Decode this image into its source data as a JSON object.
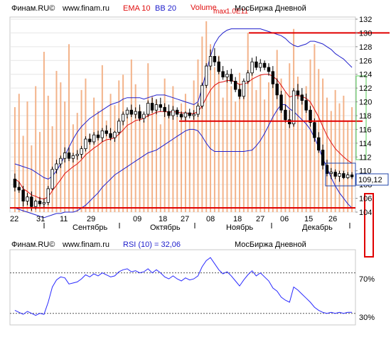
{
  "colors": {
    "frame": "#cccccc",
    "plot_bg": "#ffffff",
    "outer_bg": "#ffffff",
    "volume": "#f3b38a",
    "ema": "#e01010",
    "bollinger": "#2020cc",
    "rsi": "#2a2aff",
    "annotation_red": "#e00000",
    "annotation_blue": "#2244aa",
    "annotation_green": "#55cc55",
    "grid": "#e6e6e6",
    "text": "#000000"
  },
  "main_panel": {
    "source_label": "Финам.RU©",
    "site_label": "www.finam.ru",
    "ema_label": "EMA 10",
    "bb_label": "BB 20",
    "volume_label": "Volume",
    "max_label": "max",
    "max_value": "1.0E11",
    "exchange_label": "МосБиржа Дневной",
    "last_price_badge": "109,12"
  },
  "rsi_panel": {
    "source_label": "Финам.RU©",
    "site_label": "www.finam.ru",
    "rsi_label": "RSI (10) = 32,06",
    "exchange_label": "МосБиржа Дневной",
    "level_high": "70%",
    "level_low": "30%"
  },
  "chart_data": [
    {
      "type": "candlestick",
      "title": "МосБиржа Дневной",
      "y_ticks": [
        "104",
        "106",
        "108",
        "110",
        "112",
        "114",
        "116",
        "118",
        "120",
        "122",
        "124",
        "126",
        "128",
        "130",
        "132"
      ],
      "ylim": [
        104,
        132
      ],
      "x_ticks": [
        "22",
        "31",
        "11",
        "29",
        "09",
        "18",
        "27",
        "08",
        "18",
        "27",
        "06",
        "15",
        "26"
      ],
      "months": [
        "Сентябрь",
        "Октябрь",
        "Ноябрь",
        "Декабрь"
      ],
      "candles": [
        [
          108.8,
          109.6,
          107.0,
          107.6
        ],
        [
          107.6,
          108.4,
          106.8,
          107.2
        ],
        [
          107.2,
          107.8,
          104.8,
          105.6
        ],
        [
          105.6,
          106.8,
          105.0,
          106.2
        ],
        [
          106.2,
          107.0,
          104.2,
          104.8
        ],
        [
          104.8,
          105.8,
          104.4,
          105.6
        ],
        [
          105.6,
          106.2,
          104.8,
          105.2
        ],
        [
          105.2,
          106.0,
          104.6,
          105.4
        ],
        [
          105.4,
          107.8,
          105.0,
          107.4
        ],
        [
          107.4,
          110.6,
          107.2,
          110.2
        ],
        [
          110.2,
          111.6,
          109.6,
          111.0
        ],
        [
          111.0,
          112.2,
          110.4,
          111.8
        ],
        [
          111.8,
          113.4,
          111.2,
          112.6
        ],
        [
          112.6,
          113.4,
          111.4,
          111.8
        ],
        [
          111.8,
          112.6,
          111.2,
          112.2
        ],
        [
          112.2,
          113.0,
          111.6,
          112.4
        ],
        [
          112.4,
          113.6,
          111.8,
          113.2
        ],
        [
          113.2,
          115.0,
          112.8,
          114.6
        ],
        [
          114.6,
          115.4,
          113.8,
          114.2
        ],
        [
          114.2,
          115.6,
          113.8,
          115.2
        ],
        [
          115.2,
          115.8,
          114.4,
          114.8
        ],
        [
          114.8,
          116.2,
          114.2,
          115.8
        ],
        [
          115.8,
          116.6,
          115.0,
          115.4
        ],
        [
          115.4,
          116.2,
          114.4,
          114.8
        ],
        [
          114.8,
          115.8,
          114.2,
          115.6
        ],
        [
          115.6,
          117.6,
          115.2,
          117.2
        ],
        [
          117.2,
          118.6,
          116.6,
          118.2
        ],
        [
          118.2,
          119.2,
          117.6,
          118.8
        ],
        [
          118.8,
          119.6,
          117.8,
          118.2
        ],
        [
          118.2,
          119.2,
          117.6,
          118.6
        ],
        [
          118.6,
          119.6,
          117.2,
          117.6
        ],
        [
          117.6,
          118.6,
          117.0,
          118.2
        ],
        [
          118.2,
          120.2,
          117.8,
          119.8
        ],
        [
          119.8,
          120.6,
          118.4,
          118.8
        ],
        [
          118.8,
          120.4,
          118.2,
          119.6
        ],
        [
          119.6,
          120.6,
          118.6,
          119.2
        ],
        [
          119.2,
          119.8,
          117.8,
          118.6
        ],
        [
          118.6,
          119.6,
          117.6,
          118.0
        ],
        [
          118.0,
          119.4,
          117.4,
          118.8
        ],
        [
          118.8,
          119.2,
          117.8,
          118.2
        ],
        [
          118.2,
          118.6,
          117.4,
          117.8
        ],
        [
          117.8,
          118.6,
          117.2,
          118.4
        ],
        [
          118.4,
          119.0,
          117.6,
          118.0
        ],
        [
          118.0,
          118.8,
          117.4,
          118.2
        ],
        [
          118.2,
          119.8,
          117.8,
          119.4
        ],
        [
          119.4,
          122.8,
          119.0,
          122.4
        ],
        [
          122.4,
          125.6,
          122.0,
          125.2
        ],
        [
          125.2,
          127.6,
          124.6,
          126.6
        ],
        [
          126.6,
          127.8,
          125.2,
          125.8
        ],
        [
          125.8,
          126.6,
          124.0,
          124.4
        ],
        [
          124.4,
          125.2,
          123.2,
          123.6
        ],
        [
          123.6,
          124.6,
          122.8,
          124.0
        ],
        [
          124.0,
          124.8,
          122.6,
          123.0
        ],
        [
          123.0,
          123.6,
          121.4,
          121.8
        ],
        [
          121.8,
          122.6,
          120.4,
          120.8
        ],
        [
          120.8,
          123.4,
          120.4,
          123.0
        ],
        [
          123.0,
          124.6,
          122.6,
          124.2
        ],
        [
          124.2,
          126.4,
          123.8,
          125.8
        ],
        [
          125.8,
          126.6,
          124.6,
          125.0
        ],
        [
          125.0,
          126.2,
          124.4,
          125.6
        ],
        [
          125.6,
          126.0,
          124.6,
          125.0
        ],
        [
          125.0,
          125.6,
          123.8,
          124.4
        ],
        [
          124.4,
          125.2,
          122.0,
          122.6
        ],
        [
          122.6,
          123.4,
          120.4,
          121.0
        ],
        [
          121.0,
          121.6,
          118.4,
          118.8
        ],
        [
          118.8,
          119.6,
          117.0,
          117.4
        ],
        [
          117.4,
          118.8,
          116.2,
          116.8
        ],
        [
          116.8,
          122.0,
          116.4,
          121.6
        ],
        [
          121.6,
          122.6,
          120.4,
          121.0
        ],
        [
          121.0,
          122.0,
          119.6,
          120.2
        ],
        [
          120.2,
          121.2,
          118.4,
          118.8
        ],
        [
          118.8,
          119.4,
          116.4,
          117.0
        ],
        [
          117.0,
          117.6,
          114.2,
          114.8
        ],
        [
          114.8,
          115.6,
          112.6,
          113.0
        ],
        [
          113.0,
          113.8,
          110.2,
          110.8
        ],
        [
          110.8,
          111.6,
          109.2,
          109.6
        ],
        [
          109.6,
          110.4,
          108.8,
          109.8
        ],
        [
          109.8,
          110.2,
          108.8,
          109.2
        ],
        [
          109.2,
          110.0,
          108.4,
          109.6
        ],
        [
          109.6,
          110.0,
          108.8,
          109.0
        ],
        [
          109.0,
          109.8,
          108.8,
          109.4
        ],
        [
          109.4,
          109.8,
          108.8,
          109.12
        ]
      ],
      "ema10": [
        108.8,
        108.4,
        107.4,
        107.0,
        106.5,
        106.3,
        106.0,
        105.9,
        106.2,
        107.1,
        107.9,
        108.7,
        109.6,
        110.1,
        110.6,
        111.0,
        111.6,
        112.3,
        112.8,
        113.3,
        113.7,
        114.2,
        114.5,
        114.6,
        114.8,
        115.3,
        115.9,
        116.6,
        116.9,
        117.3,
        117.4,
        117.6,
        118.0,
        118.2,
        118.5,
        118.6,
        118.6,
        118.5,
        118.6,
        118.5,
        118.4,
        118.4,
        118.3,
        118.3,
        118.6,
        119.4,
        120.6,
        121.7,
        122.4,
        122.8,
        122.9,
        123.1,
        123.1,
        122.9,
        122.5,
        122.6,
        122.8,
        123.3,
        123.6,
        123.9,
        124.0,
        124.0,
        123.7,
        123.2,
        122.4,
        121.5,
        120.7,
        120.9,
        120.9,
        120.8,
        120.5,
        120.0,
        118.9,
        117.8,
        116.4,
        115.1,
        114.1,
        113.2,
        112.6,
        112.0,
        111.5,
        111.1
      ],
      "bb_upper": [
        111.0,
        110.8,
        110.6,
        110.4,
        110.2,
        109.8,
        109.4,
        109.0,
        108.8,
        109.2,
        110.0,
        111.0,
        112.2,
        113.4,
        114.6,
        115.6,
        116.4,
        117.0,
        117.6,
        118.0,
        118.4,
        118.8,
        119.2,
        119.6,
        119.8,
        120.0,
        120.4,
        120.6,
        120.6,
        120.6,
        120.6,
        120.4,
        120.6,
        120.8,
        121.0,
        121.0,
        121.0,
        120.8,
        120.6,
        120.4,
        120.2,
        120.0,
        119.8,
        119.6,
        120.0,
        122.0,
        124.4,
        126.6,
        128.4,
        129.4,
        130.0,
        130.4,
        130.6,
        130.6,
        130.6,
        130.6,
        130.6,
        130.6,
        130.6,
        130.6,
        130.4,
        130.2,
        130.0,
        129.8,
        129.6,
        129.2,
        128.6,
        128.2,
        128.0,
        128.2,
        128.4,
        128.8,
        128.8,
        128.6,
        128.4,
        128.0,
        127.6,
        127.0,
        126.6,
        126.2,
        125.6,
        125.0
      ],
      "bb_lower": [
        104.6,
        104.4,
        104.2,
        104.0,
        103.8,
        103.6,
        103.4,
        103.2,
        103.4,
        103.6,
        103.8,
        103.8,
        104.0,
        104.0,
        104.0,
        104.2,
        104.6,
        105.0,
        105.6,
        106.2,
        106.8,
        107.6,
        108.2,
        108.8,
        109.4,
        109.8,
        110.2,
        110.6,
        111.0,
        111.4,
        111.8,
        112.2,
        112.6,
        112.8,
        113.0,
        113.4,
        113.8,
        114.2,
        114.6,
        115.0,
        115.4,
        115.8,
        116.0,
        116.0,
        115.8,
        115.0,
        114.0,
        113.2,
        112.8,
        112.8,
        112.8,
        112.8,
        112.8,
        112.8,
        112.8,
        112.8,
        112.9,
        113.0,
        113.6,
        114.4,
        115.4,
        116.6,
        117.8,
        118.8,
        119.6,
        119.6,
        119.0,
        118.6,
        118.0,
        117.4,
        116.8,
        116.0,
        114.8,
        113.4,
        111.8,
        110.4,
        109.0,
        107.8,
        106.8,
        106.0,
        105.2,
        104.6
      ],
      "volume_max": 100000000000,
      "volumes": [
        0.55,
        0.62,
        0.4,
        0.58,
        0.35,
        0.66,
        0.42,
        0.84,
        0.61,
        0.45,
        0.74,
        0.68,
        0.58,
        0.88,
        0.46,
        0.52,
        0.64,
        0.7,
        0.41,
        0.6,
        0.53,
        0.77,
        0.48,
        0.62,
        0.56,
        0.69,
        0.72,
        0.5,
        0.8,
        0.67,
        0.55,
        0.48,
        0.78,
        0.61,
        0.59,
        0.46,
        0.7,
        0.52,
        0.66,
        0.5,
        0.57,
        0.62,
        0.48,
        0.69,
        0.8,
        0.92,
        1.0,
        0.88,
        0.76,
        0.82,
        0.6,
        0.71,
        0.66,
        0.58,
        0.73,
        0.69,
        0.94,
        0.78,
        0.64,
        0.72,
        0.59,
        0.68,
        0.74,
        0.85,
        0.7,
        0.63,
        0.78,
        0.96,
        0.71,
        0.62,
        0.66,
        0.8,
        0.88,
        0.75,
        0.7,
        0.6,
        0.53,
        0.64,
        0.57,
        0.61,
        0.48,
        0.55
      ],
      "levels": [
        104.0,
        117.2,
        130.0
      ]
    },
    {
      "type": "line",
      "title": "RSI (10) = 32,06",
      "y_ticks": [
        "30%",
        "70%"
      ],
      "ylim": [
        20,
        90
      ],
      "rsi": [
        33,
        31,
        29,
        32,
        30,
        28,
        30,
        29,
        41,
        56,
        63,
        66,
        65,
        59,
        60,
        61,
        64,
        68,
        66,
        69,
        67,
        70,
        68,
        66,
        67,
        71,
        73,
        74,
        71,
        72,
        70,
        71,
        74,
        70,
        73,
        70,
        66,
        64,
        67,
        64,
        62,
        65,
        63,
        64,
        67,
        76,
        82,
        85,
        79,
        73,
        69,
        71,
        67,
        62,
        57,
        63,
        68,
        72,
        67,
        70,
        66,
        62,
        55,
        52,
        46,
        43,
        41,
        56,
        53,
        49,
        45,
        41,
        36,
        33,
        31,
        30,
        31,
        30,
        31,
        30,
        31,
        31
      ]
    }
  ]
}
